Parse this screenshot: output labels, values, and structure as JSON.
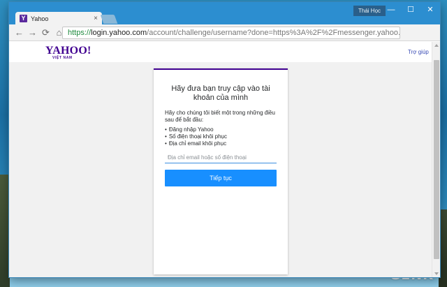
{
  "desktop": {
    "watermark": "GENK"
  },
  "window": {
    "tab_title": "Yahoo",
    "tab_favicon_letter": "Y",
    "user_badge": "Thái Học",
    "controls": {
      "minimize": "—",
      "maximize": "☐",
      "close": "✕"
    }
  },
  "toolbar": {
    "url_scheme": "https://",
    "url_host": "login.yahoo.com",
    "url_path": "/account/challenge/username?done=https%3A%2F%2Fmessenger.yahoo.com%2F&s",
    "back": "←",
    "forward": "→",
    "reload": "⟳",
    "home": "⌂",
    "zoom": "⚲",
    "star": "☆",
    "menu": "≡"
  },
  "page": {
    "logo": "YAHOO!",
    "logo_sub": "VIỆT NAM",
    "help": "Trợ giúp",
    "card": {
      "title": "Hãy đưa bạn truy cập vào tài khoản của mình",
      "description": "Hãy cho chúng tôi biết một trong những điều sau để bắt đầu:",
      "options": [
        "Đăng nhập Yahoo",
        "Số điện thoại khôi phục",
        "Địa chỉ email khôi phục"
      ],
      "input_placeholder": "Địa chỉ email hoặc số điện thoại",
      "input_value": "",
      "continue_label": "Tiếp tục"
    }
  },
  "colors": {
    "brand": "#400090",
    "accent": "#188fff",
    "titlebar": "#2c8ed0"
  }
}
